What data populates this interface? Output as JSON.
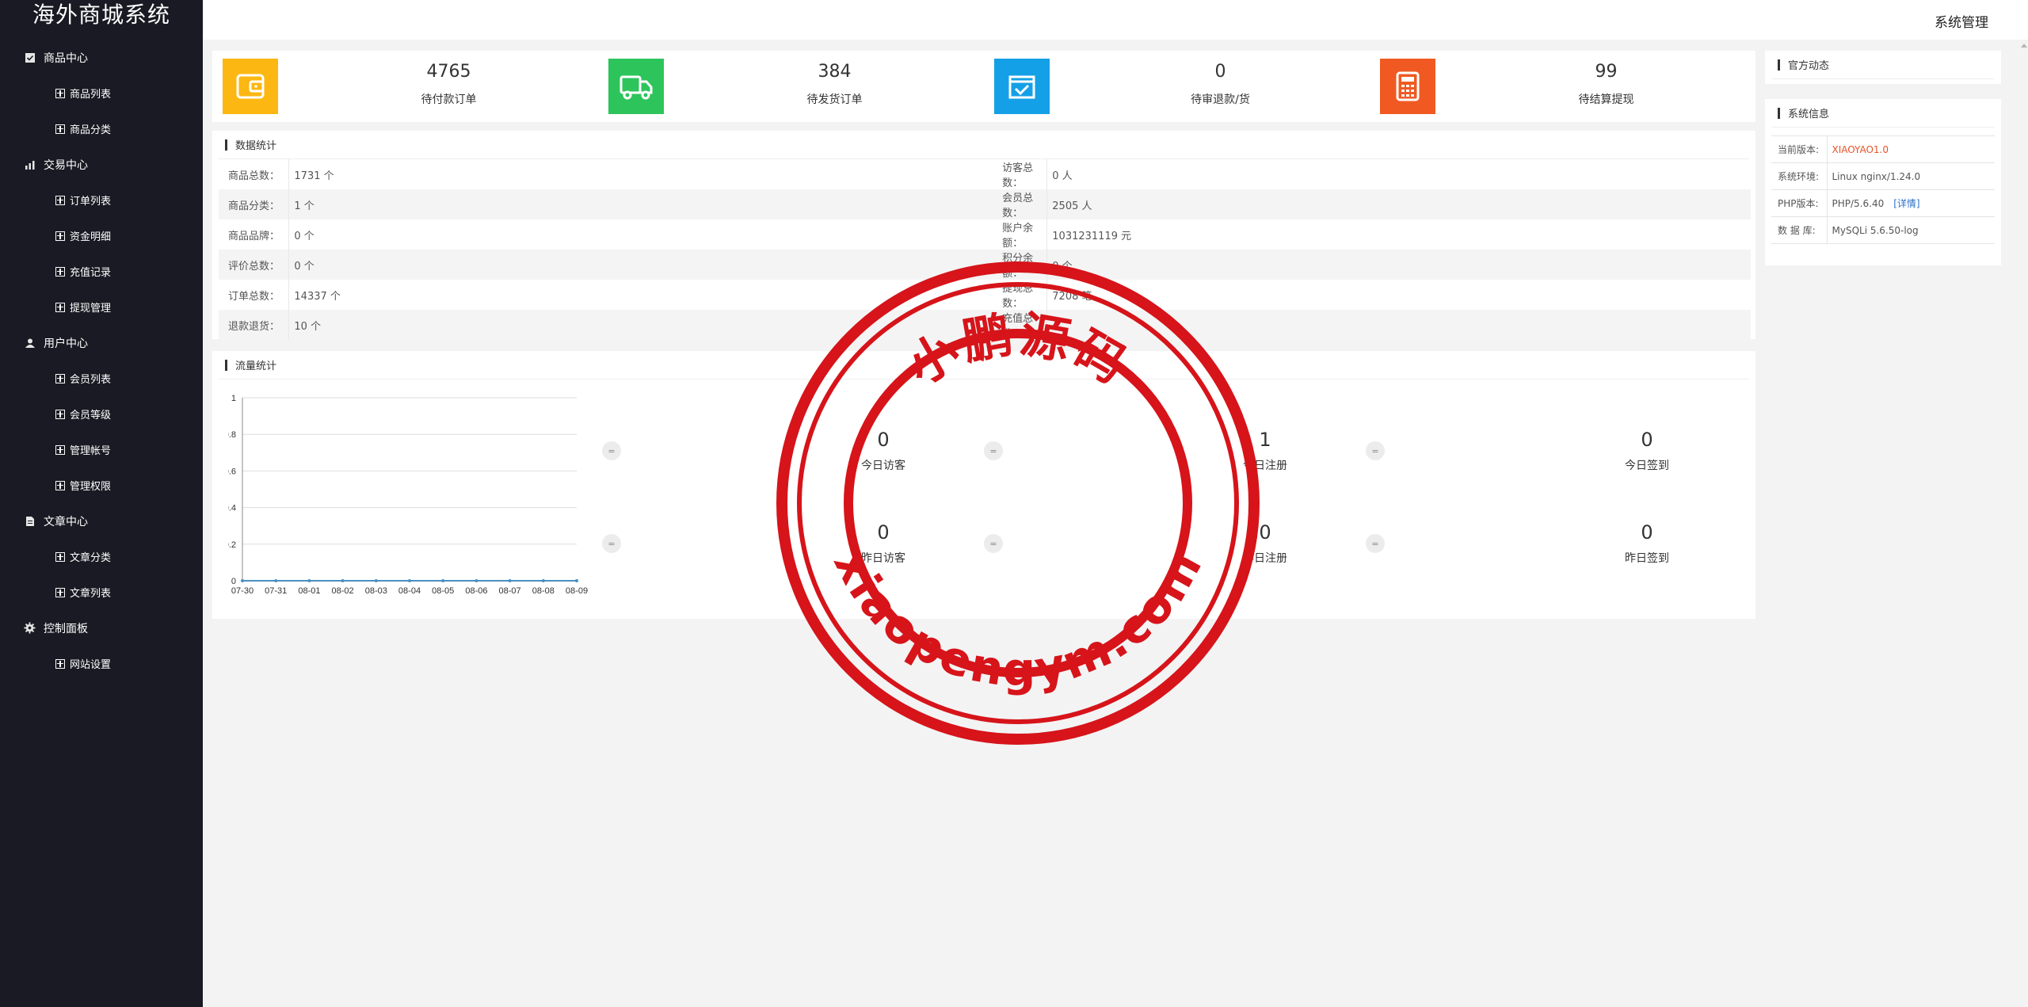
{
  "app_title": "海外商城系统",
  "header": {
    "title": "系统管理"
  },
  "sidebar": {
    "groups": [
      {
        "label": "商品中心",
        "icon": "check-square-icon",
        "items": [
          "商品列表",
          "商品分类"
        ]
      },
      {
        "label": "交易中心",
        "icon": "bar-chart-icon",
        "items": [
          "订单列表",
          "资金明细",
          "充值记录",
          "提现管理"
        ]
      },
      {
        "label": "用户中心",
        "icon": "user-icon",
        "items": [
          "会员列表",
          "会员等级",
          "管理帐号",
          "管理权限"
        ]
      },
      {
        "label": "文章中心",
        "icon": "document-icon",
        "items": [
          "文章分类",
          "文章列表"
        ]
      },
      {
        "label": "控制面板",
        "icon": "gear-icon",
        "items": [
          "网站设置"
        ]
      }
    ]
  },
  "stats": [
    {
      "value": "4765",
      "label": "待付款订单",
      "icon": "wallet-icon",
      "color": "#fcb712"
    },
    {
      "value": "384",
      "label": "待发货订单",
      "icon": "truck-icon",
      "color": "#2ec45c"
    },
    {
      "value": "0",
      "label": "待审退款/货",
      "icon": "box-check-icon",
      "color": "#14a0e6"
    },
    {
      "value": "99",
      "label": "待结算提现",
      "icon": "calculator-icon",
      "color": "#f05a22"
    }
  ],
  "data_stats": {
    "title": "数据统计",
    "rows": [
      [
        "商品总数：",
        "1731 个",
        "访客总数：",
        "0 人"
      ],
      [
        "商品分类：",
        "1 个",
        "会员总数：",
        "2505 人"
      ],
      [
        "商品品牌：",
        "0 个",
        "账户余额：",
        "1031231119 元"
      ],
      [
        "评价总数：",
        "0 个",
        "积分余额：",
        "0 个"
      ],
      [
        "订单总数：",
        "14337 个",
        "提现总数：",
        "7208 笔"
      ],
      [
        "退款退货：",
        "10 个",
        "充值总数：",
        ""
      ]
    ]
  },
  "traffic": {
    "title": "流量统计",
    "tiles": [
      {
        "icon": "=",
        "value": "0",
        "label": "今日访客"
      },
      {
        "icon": "=",
        "value": "1",
        "label": "今日注册"
      },
      {
        "icon": "=",
        "value": "0",
        "label": "今日签到"
      },
      {
        "icon": "=",
        "value": "0",
        "label": "昨日访客"
      },
      {
        "icon": "=",
        "value": "0",
        "label": "昨日注册"
      },
      {
        "icon": "=",
        "value": "0",
        "label": "昨日签到"
      }
    ]
  },
  "chart_data": {
    "type": "line",
    "categories": [
      "07-30",
      "07-31",
      "08-01",
      "08-02",
      "08-03",
      "08-04",
      "08-05",
      "08-06",
      "08-07",
      "08-08",
      "08-09"
    ],
    "series": [
      {
        "values": [
          0,
          0,
          0,
          0,
          0,
          0,
          0,
          0,
          0,
          0,
          0
        ]
      }
    ],
    "yticks": [
      "0",
      "0.2",
      "0.4",
      "0.6",
      "0.8",
      "1"
    ],
    "ylim": [
      0,
      1
    ],
    "grid": true,
    "color": "#4a90c2"
  },
  "official_news": {
    "title": "官方动态"
  },
  "system_info": {
    "title": "系统信息",
    "rows": [
      {
        "key": "当前版本:",
        "value": "XIAOYAO1.0"
      },
      {
        "key": "系统环境:",
        "value": "Linux nginx/1.24.0"
      },
      {
        "key": "PHP版本:",
        "value": "PHP/5.6.40",
        "link": "[详情]"
      },
      {
        "key": "数 据 库:",
        "value": "MySQLi 5.6.50-log"
      }
    ],
    "highlight_color": "#e8532a"
  },
  "watermark": {
    "cn": "小鹏源码",
    "url": "xiaopengym.com",
    "color": "#d6141a"
  }
}
